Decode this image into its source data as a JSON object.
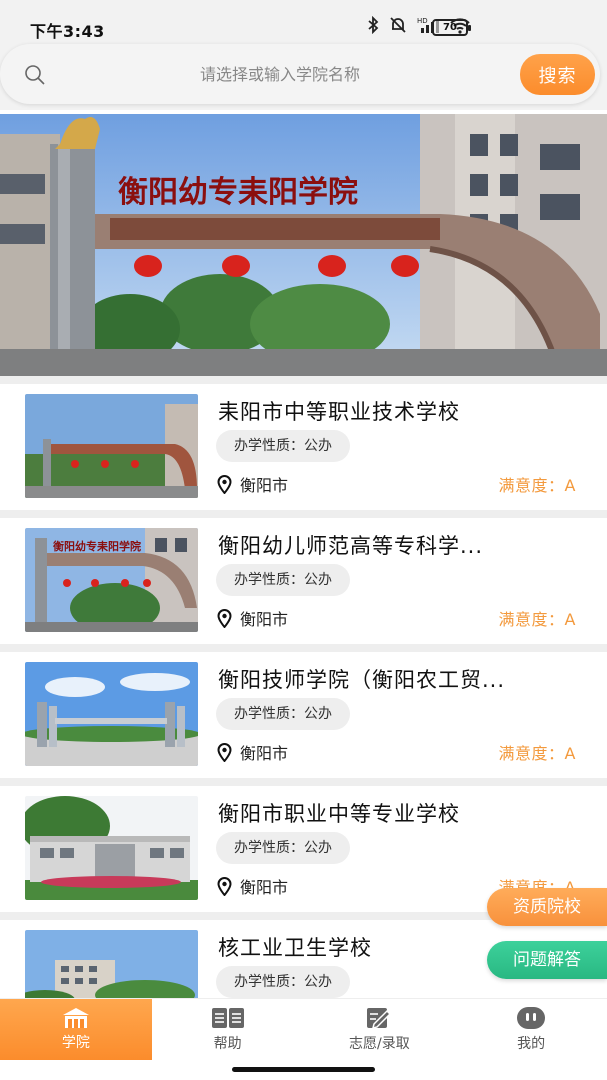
{
  "status_bar": {
    "time": "下午3:43",
    "battery": "70"
  },
  "search": {
    "placeholder": "请选择或输入学院名称",
    "button_label": "搜索"
  },
  "banner": {
    "sign_text": "衡阳幼专耒阳学院",
    "dot_count": 13
  },
  "schools": [
    {
      "name": "耒阳市中等职业技术学校",
      "nature": "办学性质：公办",
      "city": "衡阳市",
      "satisfaction": "满意度：A"
    },
    {
      "name": "衡阳幼儿师范高等专科学...",
      "nature": "办学性质：公办",
      "city": "衡阳市",
      "satisfaction": "满意度：A"
    },
    {
      "name": "衡阳技师学院（衡阳农工贸...",
      "nature": "办学性质：公办",
      "city": "衡阳市",
      "satisfaction": "满意度：A"
    },
    {
      "name": "衡阳市职业中等专业学校",
      "nature": "办学性质：公办",
      "city": "衡阳市",
      "satisfaction": "满意度：A"
    },
    {
      "name": "核工业卫生学校",
      "nature": "办学性质：公办",
      "city": "",
      "satisfaction": ""
    }
  ],
  "floating": {
    "qualified_label": "资质院校",
    "faq_label": "问题解答"
  },
  "nav": [
    {
      "label": "学院",
      "icon": "school-icon",
      "active": true
    },
    {
      "label": "帮助",
      "icon": "book-icon",
      "active": false
    },
    {
      "label": "志愿/录取",
      "icon": "edit-icon",
      "active": false
    },
    {
      "label": "我的",
      "icon": "profile-icon",
      "active": false
    }
  ],
  "colors": {
    "accent": "#fb8c2c",
    "satisfaction": "#f39a3e",
    "faq_green": "#29b882"
  }
}
